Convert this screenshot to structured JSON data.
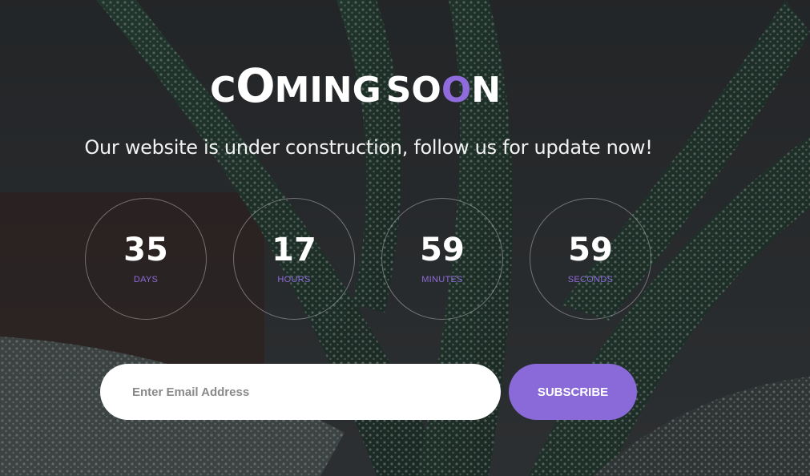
{
  "colors": {
    "accent": "#8a6ad9",
    "text": "#ffffff",
    "background": "#2a2c2e"
  },
  "header": {
    "title_parts": [
      {
        "text": "C",
        "size": "sm",
        "accent": false
      },
      {
        "text": "O",
        "size": "big",
        "accent": false
      },
      {
        "text": "MING",
        "size": "sm",
        "accent": false
      },
      {
        "text": "S",
        "size": "sm",
        "accent": false
      },
      {
        "text": "O",
        "size": "sm",
        "accent": false
      },
      {
        "text": "O",
        "size": "sm",
        "accent": true
      },
      {
        "text": "N",
        "size": "sm",
        "accent": false
      }
    ],
    "subtitle": "Our website is under construction, follow us for update now!"
  },
  "countdown": [
    {
      "value": "35",
      "unit": "Days"
    },
    {
      "value": "17",
      "unit": "Hours"
    },
    {
      "value": "59",
      "unit": "Minutes"
    },
    {
      "value": "59",
      "unit": "Seconds"
    }
  ],
  "subscribe": {
    "placeholder": "Enter Email Address",
    "button_label": "SUBSCRIBE"
  }
}
